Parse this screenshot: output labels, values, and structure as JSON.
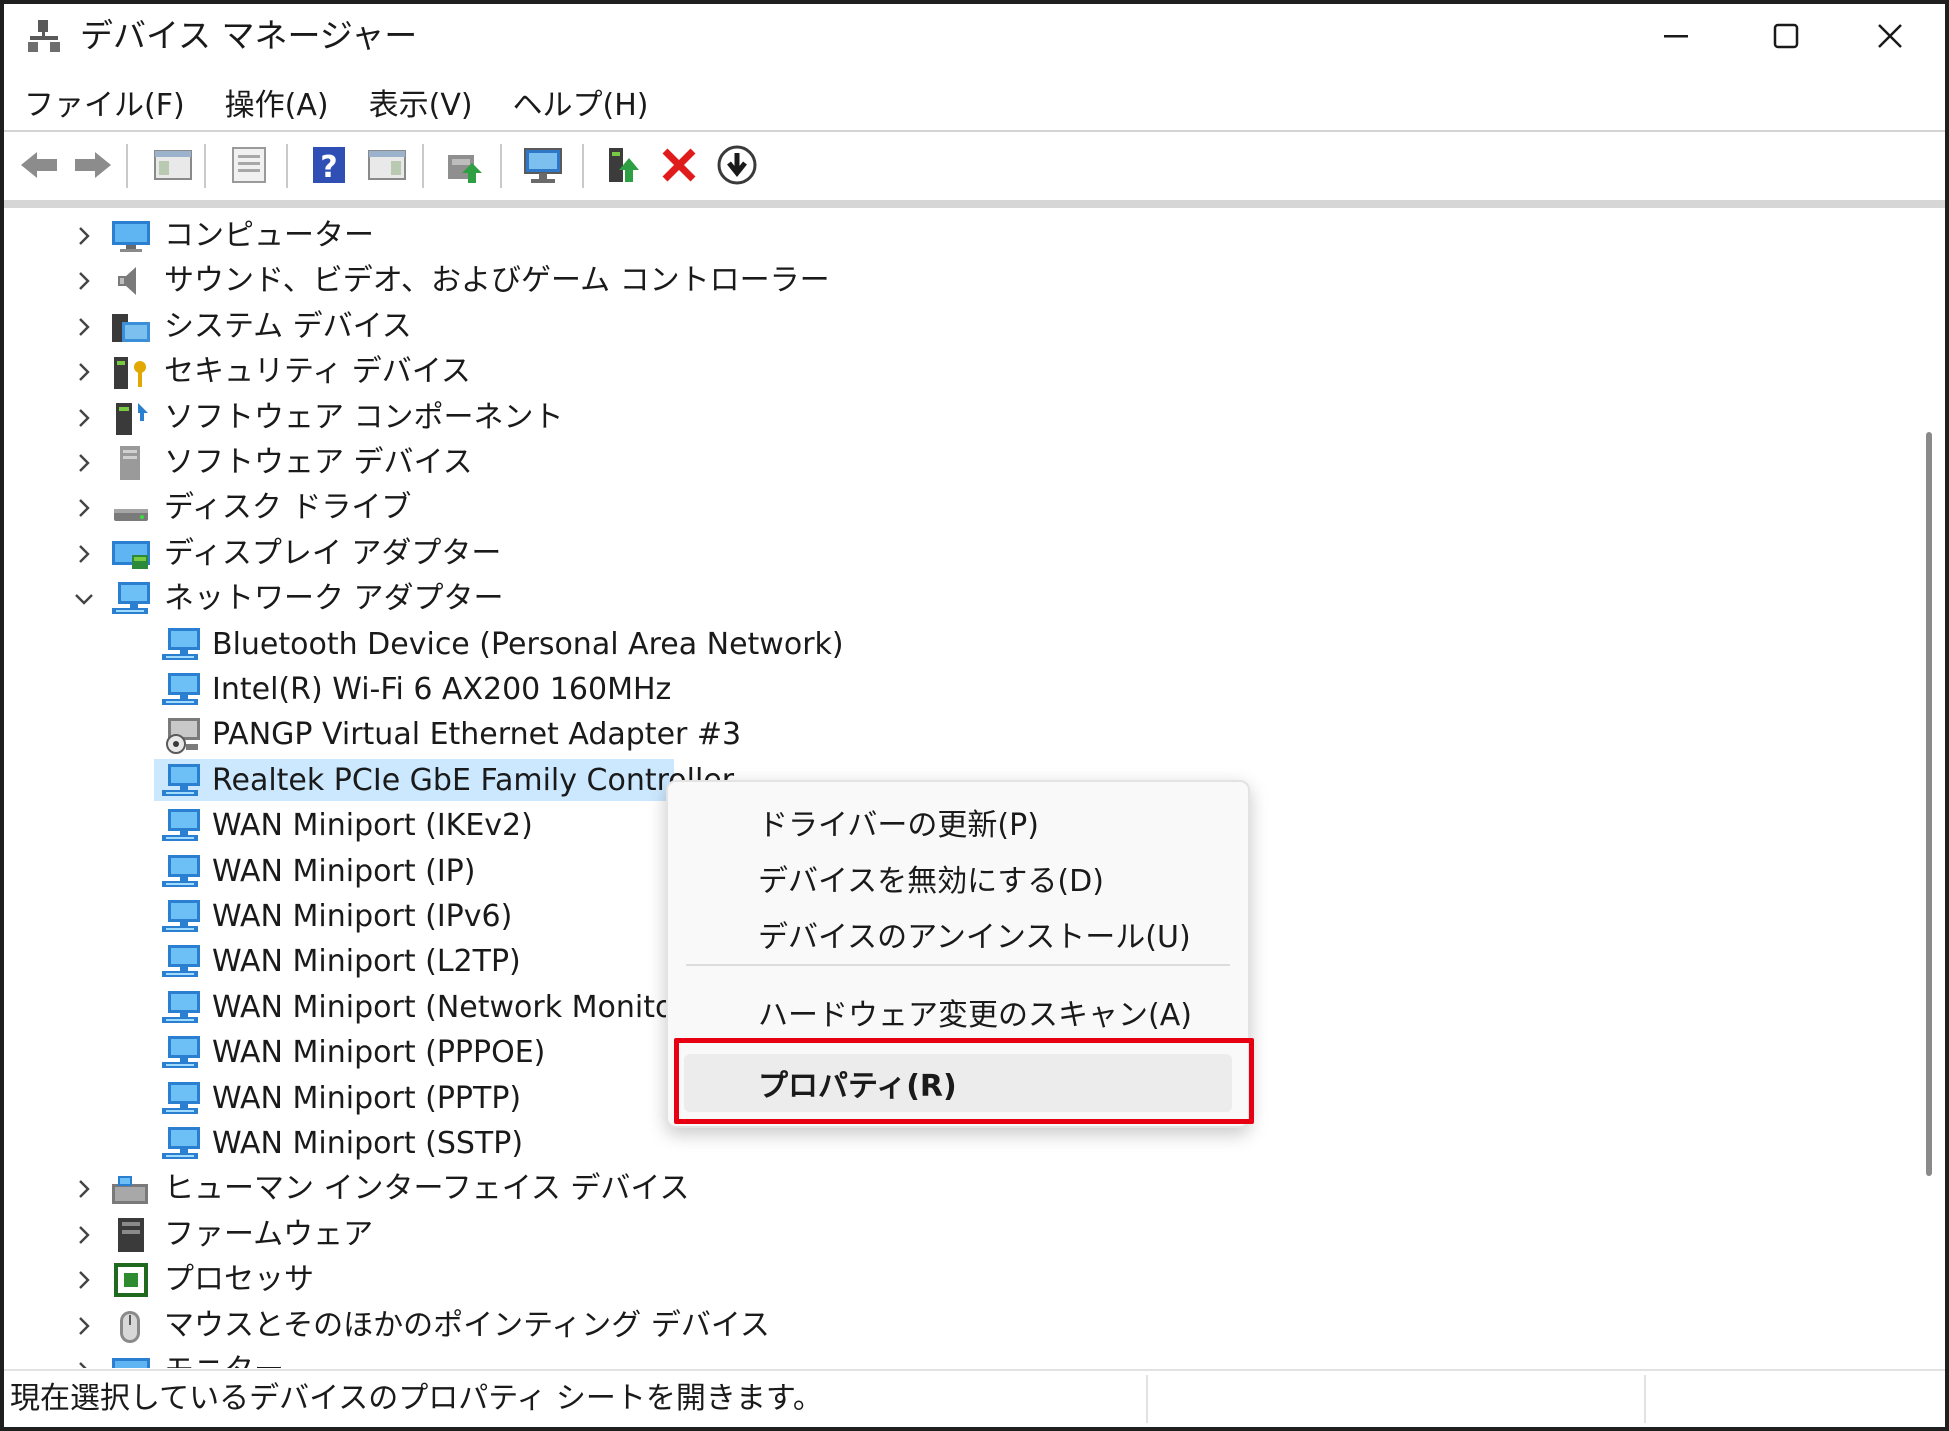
{
  "window": {
    "title": "デバイス マネージャー"
  },
  "menubar": {
    "items": [
      "ファイル(F)",
      "操作(A)",
      "表示(V)",
      "ヘルプ(H)"
    ]
  },
  "toolbar": {
    "icons": [
      "back-arrow-icon",
      "forward-arrow-icon",
      "show-hide-console-tree-icon",
      "properties-icon",
      "help-icon",
      "action-pane-icon",
      "update-driver-icon",
      "scan-hardware-icon",
      "enable-device-icon",
      "uninstall-device-icon",
      "disable-device-icon"
    ]
  },
  "tree": {
    "items": [
      {
        "label": "コンピューター",
        "expanded": false,
        "icon": "computer-icon"
      },
      {
        "label": "サウンド、ビデオ、およびゲーム コントローラー",
        "expanded": false,
        "icon": "speaker-icon"
      },
      {
        "label": "システム デバイス",
        "expanded": false,
        "icon": "system-devices-icon"
      },
      {
        "label": "セキュリティ デバイス",
        "expanded": false,
        "icon": "security-key-icon"
      },
      {
        "label": "ソフトウェア コンポーネント",
        "expanded": false,
        "icon": "software-component-icon"
      },
      {
        "label": "ソフトウェア デバイス",
        "expanded": false,
        "icon": "software-device-icon"
      },
      {
        "label": "ディスク ドライブ",
        "expanded": false,
        "icon": "disk-drive-icon"
      },
      {
        "label": "ディスプレイ アダプター",
        "expanded": false,
        "icon": "display-adapter-icon"
      },
      {
        "label": "ネットワーク アダプター",
        "expanded": true,
        "icon": "network-adapter-icon"
      }
    ],
    "network_children": [
      "Bluetooth Device (Personal Area Network)",
      "Intel(R) Wi-Fi 6 AX200 160MHz",
      "PANGP Virtual Ethernet Adapter #3",
      "Realtek PCIe GbE Family Controller",
      "WAN Miniport (IKEv2)",
      "WAN Miniport (IP)",
      "WAN Miniport (IPv6)",
      "WAN Miniport (L2TP)",
      "WAN Miniport (Network Monitor)",
      "WAN Miniport (PPPOE)",
      "WAN Miniport (PPTP)",
      "WAN Miniport (SSTP)"
    ],
    "selected_child": "Realtek PCIe GbE Family Controller",
    "items_after": [
      {
        "label": "ヒューマン インターフェイス デバイス",
        "expanded": false,
        "icon": "hid-icon"
      },
      {
        "label": "ファームウェア",
        "expanded": false,
        "icon": "firmware-icon"
      },
      {
        "label": "プロセッサ",
        "expanded": false,
        "icon": "processor-icon"
      },
      {
        "label": "マウスとそのほかのポインティング デバイス",
        "expanded": false,
        "icon": "mouse-icon"
      },
      {
        "label": "モニター",
        "expanded": false,
        "icon": "monitor-icon"
      }
    ]
  },
  "context_menu": {
    "update_driver": "ドライバーの更新(P)",
    "disable_device": "デバイスを無効にする(D)",
    "uninstall_device": "デバイスのアンインストール(U)",
    "scan_hardware": "ハードウェア変更のスキャン(A)",
    "properties": "プロパティ(R)",
    "highlight_color": "#e60012"
  },
  "statusbar": {
    "text": "現在選択しているデバイスのプロパティ シートを開きます。"
  },
  "colors": {
    "selection": "#cce8ff",
    "network_blue": "#1e88d2"
  }
}
